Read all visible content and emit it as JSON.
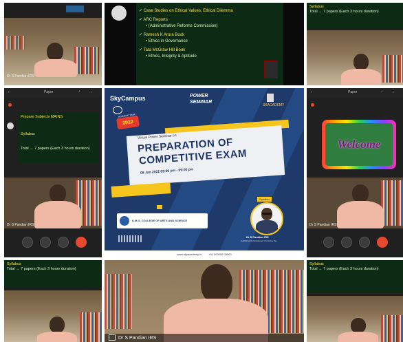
{
  "slide": {
    "items": [
      {
        "text": "Case Studies on Ethical Values, Ethical Dilemma"
      },
      {
        "text": "ARC Reports"
      },
      {
        "text": "(Administrative Reforms Commission)"
      },
      {
        "text": "Ramesh K Arora Book"
      },
      {
        "text": "Ethics in Governance"
      },
      {
        "text": "Tata McGraw Hill Book"
      },
      {
        "text": "Ethics, Integrity & Aptitude"
      }
    ]
  },
  "tiles": {
    "participant_name": "Dr S Pandian IRS",
    "small_header": "Paper",
    "notes_title": "Syllabus",
    "notes_line": "Total → 7 papers (Each 3 hours duration)",
    "notes_heading": "Prepare Subjects MAINS"
  },
  "poster": {
    "brand_left": "SkyCampus",
    "brand_mid_top": "POWER",
    "brand_mid_bottom": "SEMINAR",
    "brand_right": "SKACADEMY",
    "badge_year": "2022",
    "badge_top": "ACADEMIC YEAR",
    "subtitle": "Virtual Power Seminar on",
    "title_line1": "PREPARATION OF",
    "title_line2": "COMPETITIVE EXAM",
    "date": "08 Jan 2022  09:00 pm - 09:00 pm",
    "speaker_tag": "Speaker",
    "speaker_name": "Dr S Pandian IRS",
    "speaker_role": "Additional Commissioner of Income Tax",
    "college": "K.M.G. COLLEGE OF ARTS AND SCIENCE",
    "footer_url": "www.skyacademy.in",
    "footer_phone": "+91 000000 00000"
  },
  "welcome": {
    "text": "Welcome"
  },
  "bottom_name": "Dr S Pandian IRS",
  "colors": {
    "end_call": "#e64a2e",
    "poster_bg": "#1d3a6b",
    "chalk": "#0c2a14",
    "accent": "#f7c61e"
  }
}
